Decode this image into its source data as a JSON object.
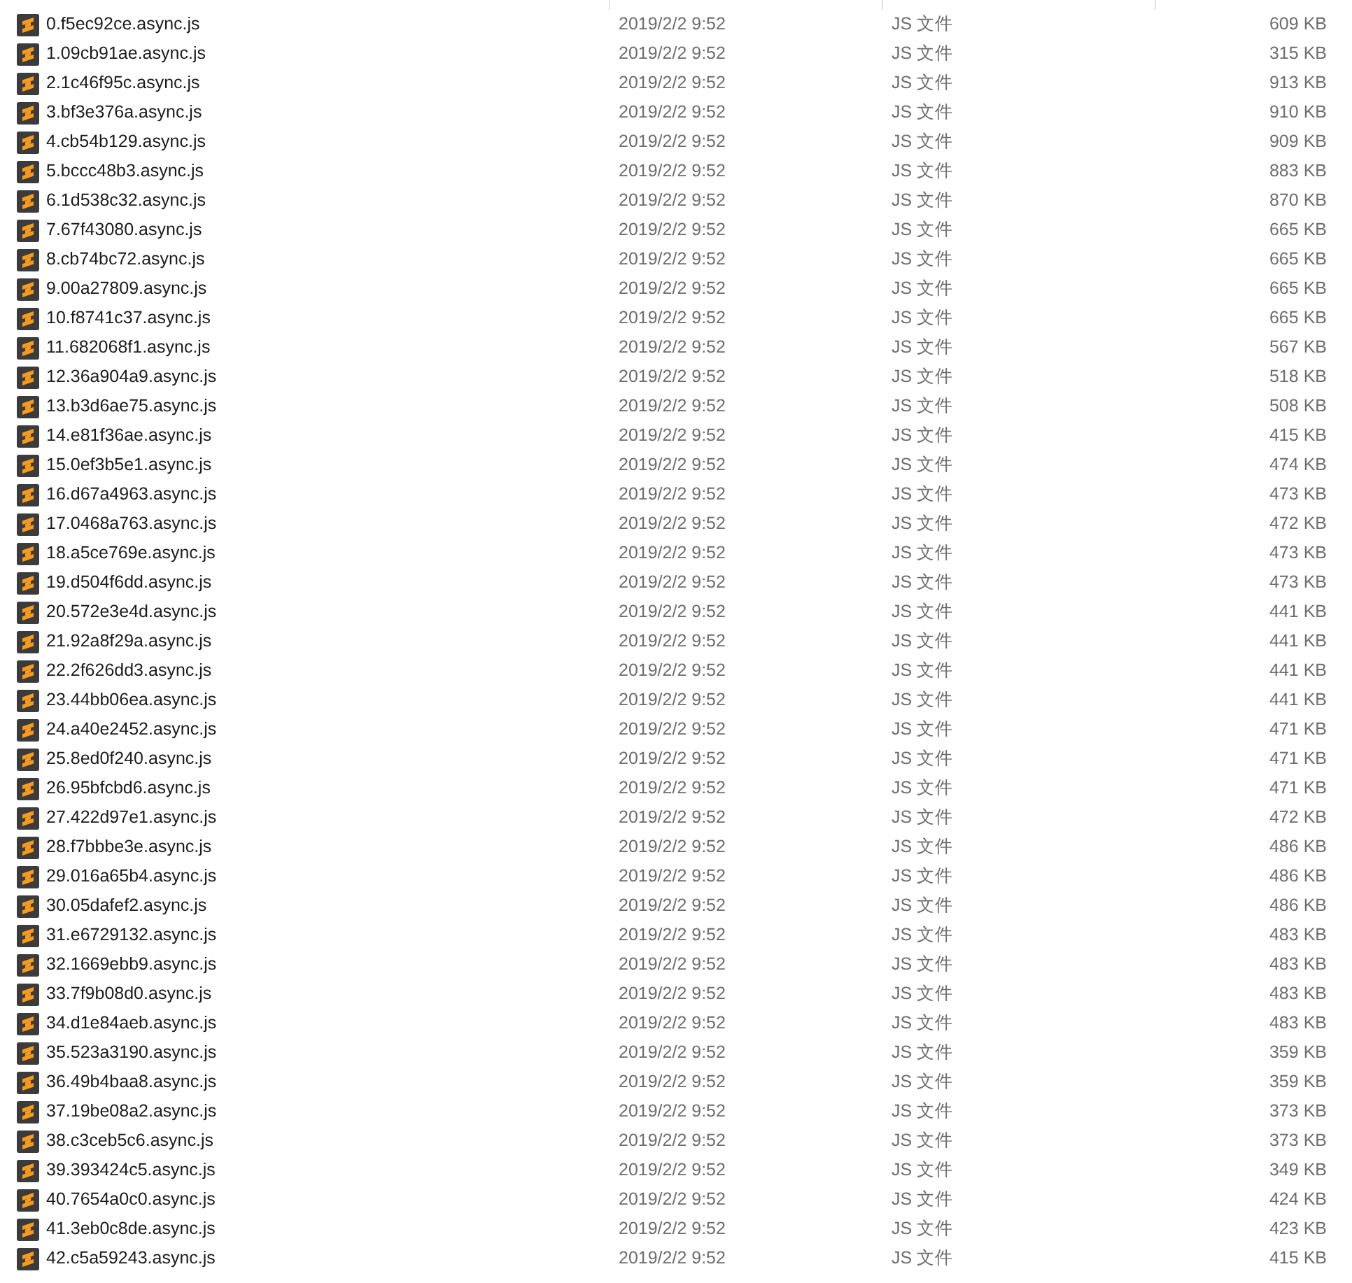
{
  "rows": [
    {
      "name": "0.f5ec92ce.async.js",
      "date": "2019/2/2 9:52",
      "type": "JS 文件",
      "size": "609 KB"
    },
    {
      "name": "1.09cb91ae.async.js",
      "date": "2019/2/2 9:52",
      "type": "JS 文件",
      "size": "315 KB"
    },
    {
      "name": "2.1c46f95c.async.js",
      "date": "2019/2/2 9:52",
      "type": "JS 文件",
      "size": "913 KB"
    },
    {
      "name": "3.bf3e376a.async.js",
      "date": "2019/2/2 9:52",
      "type": "JS 文件",
      "size": "910 KB"
    },
    {
      "name": "4.cb54b129.async.js",
      "date": "2019/2/2 9:52",
      "type": "JS 文件",
      "size": "909 KB"
    },
    {
      "name": "5.bccc48b3.async.js",
      "date": "2019/2/2 9:52",
      "type": "JS 文件",
      "size": "883 KB"
    },
    {
      "name": "6.1d538c32.async.js",
      "date": "2019/2/2 9:52",
      "type": "JS 文件",
      "size": "870 KB"
    },
    {
      "name": "7.67f43080.async.js",
      "date": "2019/2/2 9:52",
      "type": "JS 文件",
      "size": "665 KB"
    },
    {
      "name": "8.cb74bc72.async.js",
      "date": "2019/2/2 9:52",
      "type": "JS 文件",
      "size": "665 KB"
    },
    {
      "name": "9.00a27809.async.js",
      "date": "2019/2/2 9:52",
      "type": "JS 文件",
      "size": "665 KB"
    },
    {
      "name": "10.f8741c37.async.js",
      "date": "2019/2/2 9:52",
      "type": "JS 文件",
      "size": "665 KB"
    },
    {
      "name": "11.682068f1.async.js",
      "date": "2019/2/2 9:52",
      "type": "JS 文件",
      "size": "567 KB"
    },
    {
      "name": "12.36a904a9.async.js",
      "date": "2019/2/2 9:52",
      "type": "JS 文件",
      "size": "518 KB"
    },
    {
      "name": "13.b3d6ae75.async.js",
      "date": "2019/2/2 9:52",
      "type": "JS 文件",
      "size": "508 KB"
    },
    {
      "name": "14.e81f36ae.async.js",
      "date": "2019/2/2 9:52",
      "type": "JS 文件",
      "size": "415 KB"
    },
    {
      "name": "15.0ef3b5e1.async.js",
      "date": "2019/2/2 9:52",
      "type": "JS 文件",
      "size": "474 KB"
    },
    {
      "name": "16.d67a4963.async.js",
      "date": "2019/2/2 9:52",
      "type": "JS 文件",
      "size": "473 KB"
    },
    {
      "name": "17.0468a763.async.js",
      "date": "2019/2/2 9:52",
      "type": "JS 文件",
      "size": "472 KB"
    },
    {
      "name": "18.a5ce769e.async.js",
      "date": "2019/2/2 9:52",
      "type": "JS 文件",
      "size": "473 KB"
    },
    {
      "name": "19.d504f6dd.async.js",
      "date": "2019/2/2 9:52",
      "type": "JS 文件",
      "size": "473 KB"
    },
    {
      "name": "20.572e3e4d.async.js",
      "date": "2019/2/2 9:52",
      "type": "JS 文件",
      "size": "441 KB"
    },
    {
      "name": "21.92a8f29a.async.js",
      "date": "2019/2/2 9:52",
      "type": "JS 文件",
      "size": "441 KB"
    },
    {
      "name": "22.2f626dd3.async.js",
      "date": "2019/2/2 9:52",
      "type": "JS 文件",
      "size": "441 KB"
    },
    {
      "name": "23.44bb06ea.async.js",
      "date": "2019/2/2 9:52",
      "type": "JS 文件",
      "size": "441 KB"
    },
    {
      "name": "24.a40e2452.async.js",
      "date": "2019/2/2 9:52",
      "type": "JS 文件",
      "size": "471 KB"
    },
    {
      "name": "25.8ed0f240.async.js",
      "date": "2019/2/2 9:52",
      "type": "JS 文件",
      "size": "471 KB"
    },
    {
      "name": "26.95bfcbd6.async.js",
      "date": "2019/2/2 9:52",
      "type": "JS 文件",
      "size": "471 KB"
    },
    {
      "name": "27.422d97e1.async.js",
      "date": "2019/2/2 9:52",
      "type": "JS 文件",
      "size": "472 KB"
    },
    {
      "name": "28.f7bbbe3e.async.js",
      "date": "2019/2/2 9:52",
      "type": "JS 文件",
      "size": "486 KB"
    },
    {
      "name": "29.016a65b4.async.js",
      "date": "2019/2/2 9:52",
      "type": "JS 文件",
      "size": "486 KB"
    },
    {
      "name": "30.05dafef2.async.js",
      "date": "2019/2/2 9:52",
      "type": "JS 文件",
      "size": "486 KB"
    },
    {
      "name": "31.e6729132.async.js",
      "date": "2019/2/2 9:52",
      "type": "JS 文件",
      "size": "483 KB"
    },
    {
      "name": "32.1669ebb9.async.js",
      "date": "2019/2/2 9:52",
      "type": "JS 文件",
      "size": "483 KB"
    },
    {
      "name": "33.7f9b08d0.async.js",
      "date": "2019/2/2 9:52",
      "type": "JS 文件",
      "size": "483 KB"
    },
    {
      "name": "34.d1e84aeb.async.js",
      "date": "2019/2/2 9:52",
      "type": "JS 文件",
      "size": "483 KB"
    },
    {
      "name": "35.523a3190.async.js",
      "date": "2019/2/2 9:52",
      "type": "JS 文件",
      "size": "359 KB"
    },
    {
      "name": "36.49b4baa8.async.js",
      "date": "2019/2/2 9:52",
      "type": "JS 文件",
      "size": "359 KB"
    },
    {
      "name": "37.19be08a2.async.js",
      "date": "2019/2/2 9:52",
      "type": "JS 文件",
      "size": "373 KB"
    },
    {
      "name": "38.c3ceb5c6.async.js",
      "date": "2019/2/2 9:52",
      "type": "JS 文件",
      "size": "373 KB"
    },
    {
      "name": "39.393424c5.async.js",
      "date": "2019/2/2 9:52",
      "type": "JS 文件",
      "size": "349 KB"
    },
    {
      "name": "40.7654a0c0.async.js",
      "date": "2019/2/2 9:52",
      "type": "JS 文件",
      "size": "424 KB"
    },
    {
      "name": "41.3eb0c8de.async.js",
      "date": "2019/2/2 9:52",
      "type": "JS 文件",
      "size": "423 KB"
    },
    {
      "name": "42.c5a59243.async.js",
      "date": "2019/2/2 9:52",
      "type": "JS 文件",
      "size": "415 KB"
    }
  ]
}
